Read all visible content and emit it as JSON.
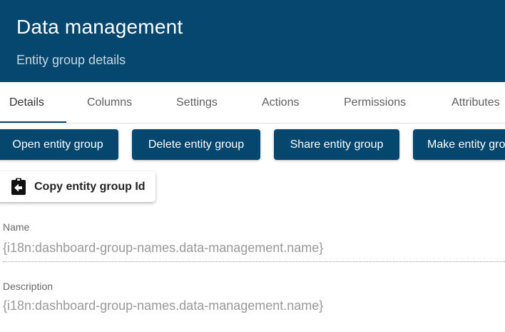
{
  "header": {
    "title": "Data management",
    "subtitle": "Entity group details"
  },
  "tabs": [
    {
      "label": "Details",
      "active": true
    },
    {
      "label": "Columns",
      "active": false
    },
    {
      "label": "Settings",
      "active": false
    },
    {
      "label": "Actions",
      "active": false
    },
    {
      "label": "Permissions",
      "active": false
    },
    {
      "label": "Attributes",
      "active": false
    }
  ],
  "actions": {
    "open": "Open entity group",
    "delete": "Delete entity group",
    "share": "Share entity group",
    "make": "Make entity group public",
    "copy_id": "Copy entity group Id"
  },
  "fields": {
    "name": {
      "label": "Name",
      "value": "{i18n:dashboard-group-names.data-management.name}"
    },
    "description": {
      "label": "Description",
      "value": "{i18n:dashboard-group-names.data-management.name}"
    }
  },
  "icons": {
    "copy": "clipboard-arrow-left-icon"
  },
  "colors": {
    "primary": "#05476f",
    "subtitle": "#c9d6df",
    "field_value": "#9a9a9a"
  }
}
